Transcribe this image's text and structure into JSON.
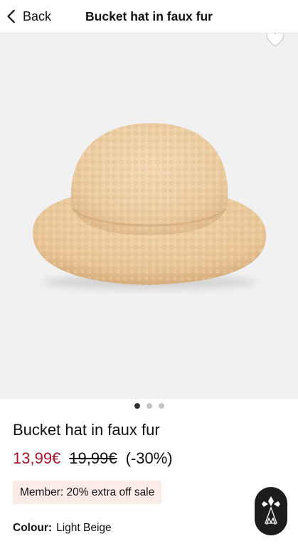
{
  "header": {
    "back_label": "Back",
    "title": "Bucket hat in faux fur"
  },
  "gallery": {
    "image_subject": "beige faux fur bucket hat",
    "dots": [
      {
        "active": true
      },
      {
        "active": false
      },
      {
        "active": false
      }
    ]
  },
  "product": {
    "name": "Bucket hat in faux fur",
    "price_sale": "13,99€",
    "price_original": "19,99€",
    "price_discount": "(-30%)",
    "member_offer": "Member: 20% extra off sale",
    "colour_label": "Colour:",
    "colour_value": "Light Beige"
  },
  "icons": {
    "back": "chevron-left-icon",
    "wishlist": "heart-icon",
    "assistant": "assistant-logo-icon"
  },
  "colors": {
    "sale_price": "#a8132b",
    "member_badge_bg": "#fbece8",
    "gallery_bg": "#f1f1f1",
    "assistant_bg": "#1d1d1d"
  }
}
